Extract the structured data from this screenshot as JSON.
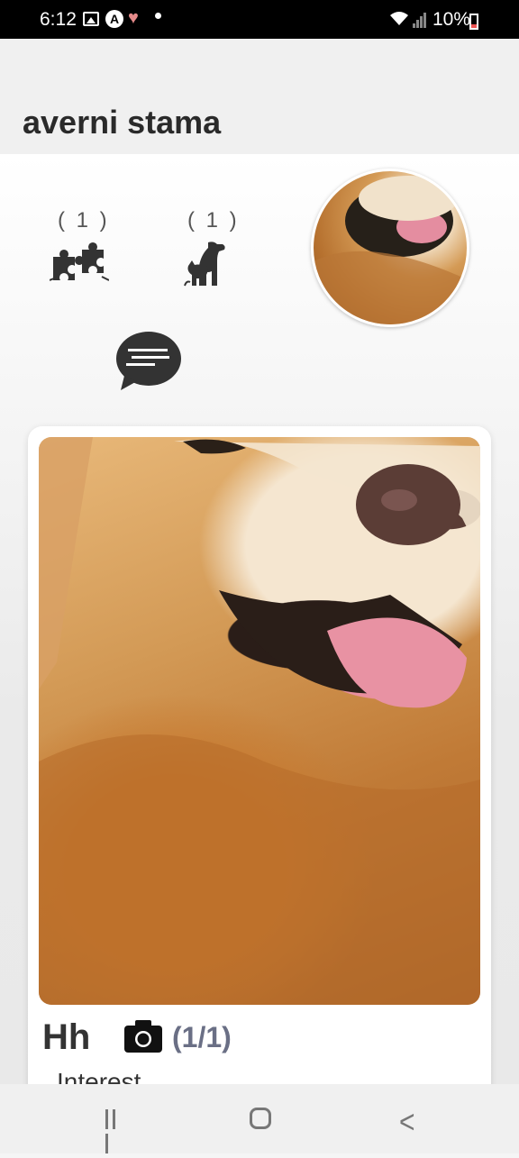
{
  "status_bar": {
    "time": "6:12",
    "battery": "10%",
    "icons": [
      "gallery-icon",
      "app-a-icon",
      "heart-pulse-icon",
      "dot-icon",
      "wifi-icon",
      "signal-icon",
      "battery-low-icon"
    ]
  },
  "header": {
    "title": "averni stama"
  },
  "stats": {
    "matches_count": "( 1 )",
    "pets_count": "( 1 )",
    "matches_icon": "puzzle-pieces-icon",
    "pets_icon": "dog-cat-icon",
    "message_icon": "chat-bubble-icon"
  },
  "card": {
    "pet_name": "Hh",
    "photo_count": "(1/1)",
    "camera_icon": "camera-icon",
    "interest_label": "Interest"
  },
  "nav": {
    "icons": [
      "recents-icon",
      "home-icon",
      "back-icon"
    ]
  },
  "colors": {
    "accent_text": "#6a6f85",
    "icon_dark": "#333333"
  }
}
